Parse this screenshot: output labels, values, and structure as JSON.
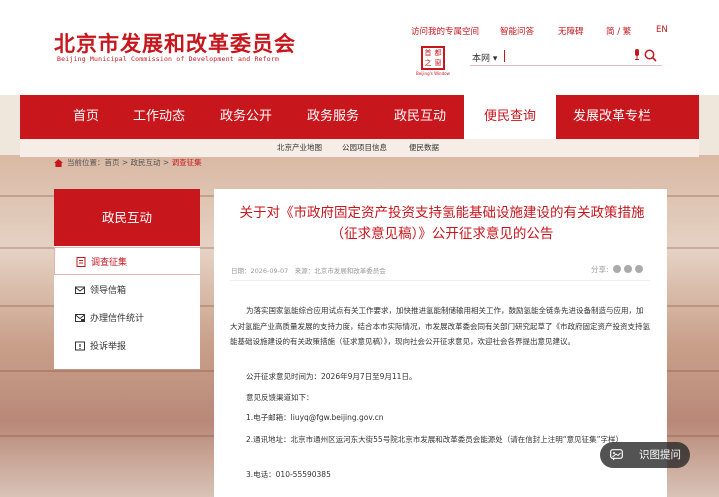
{
  "header": {
    "title": "北京市发展和改革委员会",
    "subtitle": "Beijing Municipal Commission of Development and Reform",
    "top_links": [
      "访问我的专属空间",
      "智能问答",
      "无障碍",
      "简 / 繁",
      "EN"
    ],
    "seal_chars": [
      "首",
      "都",
      "之",
      "窗"
    ],
    "seal_caption": "Beijing's Window",
    "search_scope": "本网 ▾"
  },
  "nav": {
    "items": [
      "首页",
      "工作动态",
      "政务公开",
      "政务服务",
      "政民互动",
      "便民查询",
      "发展改革专栏"
    ],
    "active_index": 5
  },
  "subnav": [
    "北京产业地图",
    "公园项目信息",
    "便民数据"
  ],
  "breadcrumb": {
    "prefix": "当前位置：",
    "path": "首页 > 政民互动 > ",
    "current": "调查征集"
  },
  "sidebar": {
    "heading": "政民互动",
    "items": [
      {
        "label": "调查征集",
        "icon": "survey-icon",
        "active": true
      },
      {
        "label": "领导信箱",
        "icon": "mail-icon",
        "active": false
      },
      {
        "label": "办理信件统计",
        "icon": "chart-mail-icon",
        "active": false
      },
      {
        "label": "投诉举报",
        "icon": "report-icon",
        "active": false
      }
    ]
  },
  "article": {
    "title": "关于对《市政府固定资产投资支持氢能基础设施建设的有关政策措施（征求意见稿）》公开征求意见的公告",
    "meta": "日期：2026-09-07　来源：北京市发展和改革委员会",
    "share_label": "分享:",
    "paragraphs": [
      "为落实国家氢能综合应用试点有关工作要求，加快推进氢能制储输用相关工作，鼓励氢能全链条先进设备制造与应用，加大对氢能产业高质量发展的支持力度，结合本市实际情况，市发展改革委会同有关部门研究起草了《市政府固定资产投资支持氢能基础设施建设的有关政策措施（征求意见稿）》，现向社会公开征求意见，欢迎社会各界提出意见建议。",
      "公开征求意见时间为：2026年9月7日至9月11日。",
      "意见反馈渠道如下：",
      "1.电子邮箱：liuyq@fgw.beijing.gov.cn",
      "2.通讯地址：北京市通州区运河东大街55号院北京市发展和改革委员会能源处（请在信封上注明“意见征集”字样）",
      "3.电话：010-55590385"
    ]
  },
  "ocr_button": "识图提问",
  "colors": {
    "brand": "#c8161d",
    "subnav_bg": "#f6eee6"
  }
}
